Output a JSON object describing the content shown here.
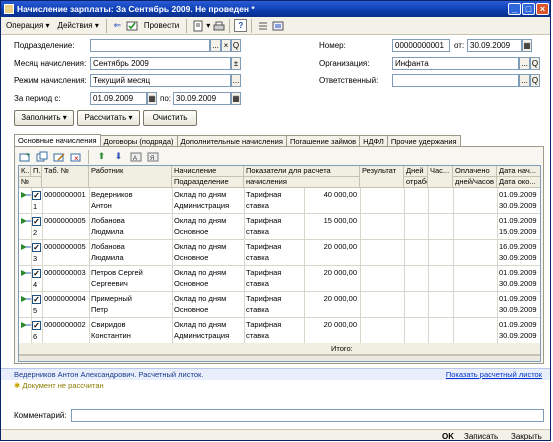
{
  "window": {
    "title": "Начисление зарплаты: За Сентябрь 2009. Не проведен *"
  },
  "toolbar": {
    "operation": "Операция",
    "actions": "Действия",
    "post": "Провести"
  },
  "form": {
    "division_label": "Подразделение:",
    "division": "",
    "month_label": "Месяц начисления:",
    "month": "Сентябрь 2009",
    "mode_label": "Режим начисления:",
    "mode": "Текущий месяц",
    "period_label": "За период с:",
    "period_from": "01.09.2009",
    "period_to_label": "по:",
    "period_to": "30.09.2009",
    "number_label": "Номер:",
    "number": "00000000001",
    "date_label": "от:",
    "date": "30.09.2009",
    "org_label": "Организация:",
    "org": "Инфанта",
    "resp_label": "Ответственный:",
    "resp": ""
  },
  "buttons": {
    "fill": "Заполнить",
    "calc": "Рассчитать",
    "clear": "Очистить"
  },
  "tabs": [
    "Основные начисления",
    "Договоры (подряда)",
    "Дополнительные начисления",
    "Погашение займов",
    "НДФЛ",
    "Прочие удержания"
  ],
  "grid": {
    "headers": {
      "k": "К...",
      "p": "П...",
      "n": "№",
      "tab": "Таб. №",
      "emp": "Работник",
      "acc": "Начисление",
      "div": "Подразделение",
      "ind1": "Показатели для расчета",
      "ind2": "начисления",
      "res": "Результат",
      "days1": "Дней",
      "days2": "отработано",
      "hrs": "Час...",
      "paid1": "Оплачено",
      "paid2": "дней/часов",
      "ds": "Дата нач...",
      "de": "Дата око..."
    },
    "rows": [
      {
        "n": "1",
        "tab": "0000000001",
        "emp1": "Ведерников",
        "emp2": "Антон",
        "acc": "Оклад по дням",
        "div": "Администрация",
        "ind": "Тарифная",
        "ind2": "ставка",
        "amt": "40 000,00",
        "ds": "01.09.2009",
        "de": "30.09.2009"
      },
      {
        "n": "2",
        "tab": "0000000005",
        "emp1": "Лобанова",
        "emp2": "Людмила",
        "acc": "Оклад по дням",
        "div": "Основное",
        "ind": "Тарифная",
        "ind2": "ставка",
        "amt": "15 000,00",
        "ds": "01.09.2009",
        "de": "15.09.2009"
      },
      {
        "n": "3",
        "tab": "0000000005",
        "emp1": "Лобанова",
        "emp2": "Людмила",
        "acc": "Оклад по дням",
        "div": "Основное",
        "ind": "Тарифная",
        "ind2": "ставка",
        "amt": "20 000,00",
        "ds": "16.09.2009",
        "de": "30.09.2009"
      },
      {
        "n": "4",
        "tab": "0000000003",
        "emp1": "Петров Сергей",
        "emp2": "Сергеевич",
        "acc": "Оклад по дням",
        "div": "Основное",
        "ind": "Тарифная",
        "ind2": "ставка",
        "amt": "20 000,00",
        "ds": "01.09.2009",
        "de": "30.09.2009"
      },
      {
        "n": "5",
        "tab": "0000000004",
        "emp1": "Примерный",
        "emp2": "Петр",
        "acc": "Оклад по дням",
        "div": "Основное",
        "ind": "Тарифная",
        "ind2": "ставка",
        "amt": "20 000,00",
        "ds": "01.09.2009",
        "de": "30.09.2009"
      },
      {
        "n": "6",
        "tab": "0000000002",
        "emp1": "Свиридов",
        "emp2": "Константин",
        "acc": "Оклад по дням",
        "div": "Администрация",
        "ind": "Тарифная",
        "ind2": "ставка",
        "amt": "20 000,00",
        "ds": "01.09.2009",
        "de": "30.09.2009"
      }
    ],
    "total_label": "Итого:"
  },
  "status": {
    "text": "Ведерников Антон Александрович. Расчетный листок.",
    "link": "Показать расчетный листок"
  },
  "warning": "Документ не рассчитан",
  "comment_label": "Комментарий:",
  "comment": "",
  "footer": {
    "ok": "OK",
    "save": "Записать",
    "close": "Закрыть"
  }
}
